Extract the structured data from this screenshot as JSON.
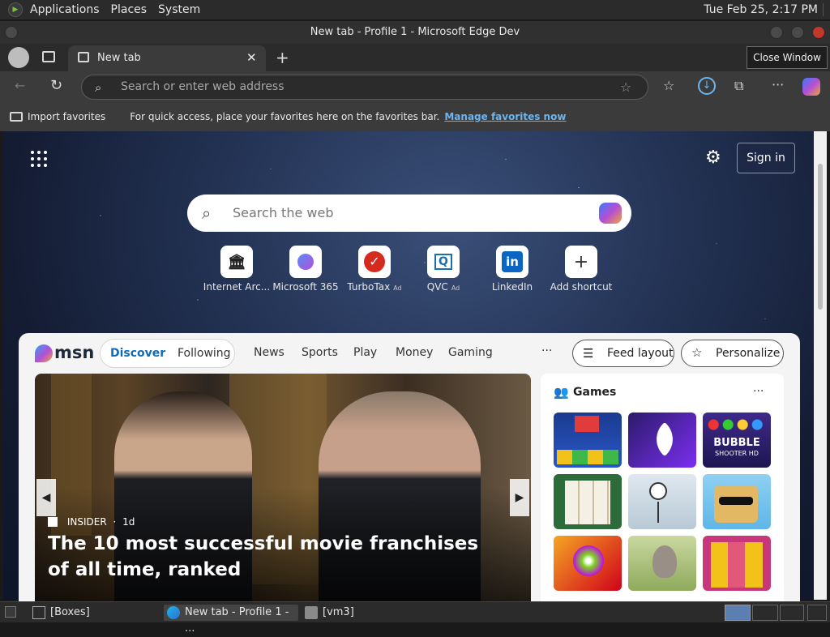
{
  "top_panel": {
    "menus": [
      "Applications",
      "Places",
      "System"
    ],
    "clock": "Tue Feb 25,  2:17 PM"
  },
  "window": {
    "title": "New tab - Profile 1 - Microsoft Edge Dev",
    "close_tooltip": "Close Window"
  },
  "browser": {
    "tab_title": "New tab",
    "address_placeholder": "Search or enter web address",
    "favorites_bar": {
      "import_label": "Import favorites",
      "hint": "For quick access, place your favorites here on the favorites bar.",
      "manage_link": "Manage favorites now"
    }
  },
  "newtab": {
    "sign_in": "Sign in",
    "web_search_placeholder": "Search the web",
    "shortcuts": [
      {
        "label": "Internet Arc...",
        "ad": "",
        "icon": "institution-icon",
        "color": "#222222"
      },
      {
        "label": "Microsoft 365",
        "ad": "",
        "icon": "m365-icon",
        "color": "#6b4fd8"
      },
      {
        "label": "TurboTax",
        "ad": "Ad",
        "icon": "turbotax-check-icon",
        "color": "#d52b1e"
      },
      {
        "label": "QVC",
        "ad": "Ad",
        "icon": "qvc-q-icon",
        "color": "#1a6fb3"
      },
      {
        "label": "LinkedIn",
        "ad": "",
        "icon": "linkedin-icon",
        "color": "#0a66c2"
      },
      {
        "label": "Add shortcut",
        "ad": "",
        "icon": "plus-icon",
        "color": "#333333"
      }
    ],
    "feed": {
      "brand": "msn",
      "tabs": [
        "Discover",
        "Following"
      ],
      "nav": [
        "News",
        "Sports",
        "Play",
        "Money",
        "Gaming"
      ],
      "more": "···",
      "feed_layout": "Feed layout",
      "personalize": "Personalize",
      "hero": {
        "source": "INSIDER",
        "age": "1d",
        "headline": "The 10 most successful movie franchises of all time, ranked"
      },
      "games": {
        "title": "Games",
        "more": "···",
        "bubble_text": "BUBBLE",
        "bubble_sub": "SHOOTER HD"
      }
    }
  },
  "taskbar": {
    "items": [
      "[Boxes]",
      "New tab - Profile 1 - ...",
      "[vm3]"
    ]
  },
  "colors": {
    "accent_blue": "#0f6cbd",
    "panel": "#2b2b2b",
    "chrome": "#3b3b3b"
  }
}
